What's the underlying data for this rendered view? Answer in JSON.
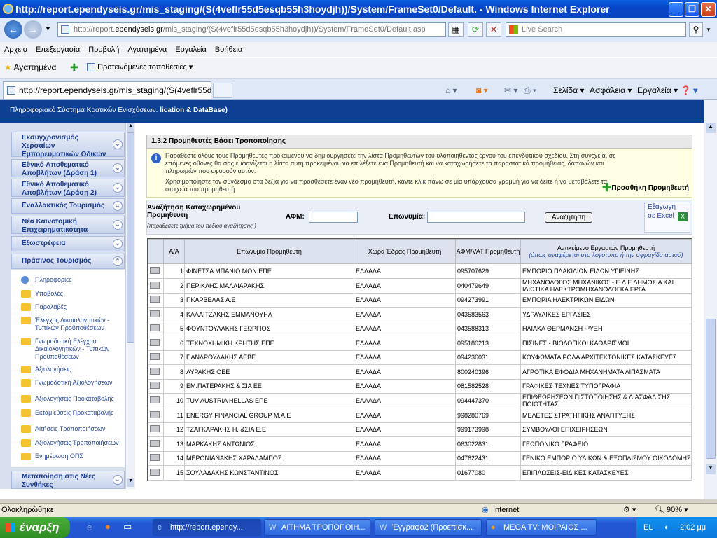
{
  "window": {
    "title": "http://report.ependyseis.gr/mis_staging/(S(4veflr55d5esqb55h3hoydjh))/System/FrameSet0/Default. - Windows Internet Explorer"
  },
  "address": {
    "prefix": "http://report.",
    "domain": "ependyseis.gr",
    "suffix": "/mis_staging/(S(4veflr55d5esqb55h3hoydjh))/System/FrameSet0/Default.asp",
    "search_placeholder": "Live Search"
  },
  "menu": [
    "Αρχείο",
    "Επεξεργασία",
    "Προβολή",
    "Αγαπημένα",
    "Εργαλεία",
    "Βοήθεια"
  ],
  "favbar": {
    "favorites": "Αγαπημένα",
    "suggested": "Προτεινόμενες τοποθεσίες"
  },
  "tab": {
    "title": "http://report.ependyseis.gr/mis_staging/(S(4veflr55d..."
  },
  "commandbar": {
    "page": "Σελίδα",
    "safety": "Ασφάλεια",
    "tools": "Εργαλεία"
  },
  "header": {
    "title": "Πληροφοριακό Σύστημα Κρατικών Ενισχύσεων.",
    "title_suffix": "lication & DataBase)"
  },
  "sidebar": {
    "sections": [
      "Εκσυγχρονισμός Χερσαίων Εμπορευματικών Οδικών Μεταφορών",
      "Εθνικό Αποθεματικό Αποβλήτων (Δράση 1)",
      "Εθνικό Αποθεματικό Αποβλήτων (Δράση 2)",
      "Εναλλακτικός Τουρισμός",
      "Νέα Καινοτομική Επιχειρηματικότητα",
      "Εξωστρέφεια",
      "Πράσινος Τουρισμός"
    ],
    "items": [
      "Πληροφορίες",
      "Υποβολές",
      "Παραλαβές",
      "Έλεγχος Δικαιολογητικών - Τυπικών Προϋποθέσεων",
      "Γνωμοδοτική Ελέγχου Δικαιολογητικών - Τυπικών Προϋποθέσεων",
      "Αξιολογήσεις",
      "Γνωμοδοτική Αξιολογήσεων",
      "Αξιολογήσεις Προκαταβολής",
      "Εκταμιεύσεις Προκαταβολής",
      "Αιτήσεις Τροποποιήσεων",
      "Αξιολογήσεις Τροποποιήσεων",
      "Ενημέρωση ΟΠΣ"
    ],
    "bottom_section": "Μεταποίηση στις Νέες Συνθήκες"
  },
  "main": {
    "section_title": "1.3.2 Προμηθευτές Βάσει Τροποποίησης",
    "info_p1": "Παραθέστε όλους τους Προμηθευτές προκειμένου να δημιουργήσετε την λίστα Προμηθευτών του υλοποιηθέντος έργου του επενδυτικού σχεδίου. Στη συνέχεια, σε επόμενες οθόνες θα σας εμφανίζεται η λίστα αυτή προκειμένου να επιλέξετε ένα Προμηθευτή και να καταχωρήσετε τα παραστατικά προμήθειας, δαπανών και πληρωμών που αφορούν αυτόν.",
    "info_p2": "Χρησιμοποιήστε τον σύνδεσμο στα δεξιά για να προσθέσετε έναν νέο προμηθευτή, κάντε κλικ πάνω σε μία υπάρχουσα γραμμή για να δείτε ή να μεταβάλετε τα στοιχεία του προμηθευτή",
    "add_supplier": "Προσθήκη Προμηθευτή",
    "search": {
      "title": "Αναζήτηση Καταχωρημένου Προμηθευτή",
      "hint": "(παραθέσετε τμήμα του πεδίου αναζήτησης )",
      "afm_label": "ΑΦΜ:",
      "name_label": "Επωνυμία:",
      "button": "Αναζήτηση",
      "export": "Εξαγωγή σε Excel"
    },
    "table": {
      "headers": {
        "aa": "Α/Α",
        "name": "Επωνυμία Προμηθευτή",
        "country": "Χώρα Έδρας Προμηθευτή",
        "afm": "ΑΦΜ/VAT Προμηθευτή",
        "object": "Αντικείμενο Εργασιών Προμηθευτή",
        "object_note": "(όπως αναφέρεται στο λογότυπο ή την σφραγίδα αυτού)"
      },
      "rows": [
        {
          "aa": "1",
          "name": "ΦΙΝΕΤΣΑ ΜΠΑΝΙΟ ΜΟΝ.ΕΠΕ",
          "country": "ΕΛΛΑΔΑ",
          "afm": "095707629",
          "object": "ΕΜΠΟΡΙΟ ΠΛΑΚΙΔΙΩΝ ΕΙΔΩΝ ΥΓΙΕΙΝΗΣ"
        },
        {
          "aa": "2",
          "name": "ΠΕΡΙΚΛΗΣ ΜΑΛΛΙΑΡΑΚΗΣ",
          "country": "ΕΛΛΑΔΑ",
          "afm": "040479649",
          "object": "ΜΗΧΑΝΟΛΟΓΟΣ ΜΗΧΑΝΙΚΟΣ - Ε.Δ.Ε ΔΗΜΟΣΙΑ ΚΑΙ ΙΔΙΩΤΙΚΑ ΗΛΕΚΤΡΟΜΗΧΑΝΟΛΟΓΚΑ ΕΡΓΑ"
        },
        {
          "aa": "3",
          "name": "Γ.ΚΑΡΒΕΛΑΣ Α.Ε",
          "country": "ΕΛΛΑΔΑ",
          "afm": "094273991",
          "object": "ΕΜΠΟΡΙΑ ΗΛΕΚΤΡΙΚΩΝ ΕΙΔΩΝ"
        },
        {
          "aa": "4",
          "name": "ΚΑΛΑΙΤΖΑΚΗΣ ΕΜΜΑΝΟΥΗΛ",
          "country": "ΕΛΛΑΔΑ",
          "afm": "043583563",
          "object": "ΥΔΡΑΥΛΙΚΕΣ ΕΡΓΑΣΙΕΣ"
        },
        {
          "aa": "5",
          "name": "ΦΟΥΝΤΟΥΛΑΚΗΣ ΓΕΩΡΓΙΟΣ",
          "country": "ΕΛΛΑΔΑ",
          "afm": "043588313",
          "object": "ΗΛΙΑΚΑ ΘΕΡΜΑΝΣΗ ΨΥΞΗ"
        },
        {
          "aa": "6",
          "name": "ΤΕΧΝΟΧΗΜΙΚΗ ΚΡΗΤΗΣ ΕΠΕ",
          "country": "ΕΛΛΑΔΑ",
          "afm": "095180213",
          "object": "ΠΙΣΙΝΕΣ - ΒΙΟΛΟΓΙΚΟΙ ΚΑΘΑΡΙΣΜΟΙ"
        },
        {
          "aa": "7",
          "name": "Γ.ΑΝΔΡΟΥΛΑΚΗΣ ΑΕΒΕ",
          "country": "ΕΛΛΑΔΑ",
          "afm": "094236031",
          "object": "ΚΟΥΦΩΜΑΤΑ ΡΟΛΑ ΑΡΧΙΤΕΚΤΟΝΙΚΕΣ ΚΑΤΑΣΚΕΥΕΣ"
        },
        {
          "aa": "8",
          "name": "ΛΥΡΑΚΗΣ ΟΕΕ",
          "country": "ΕΛΛΑΔΑ",
          "afm": "800240396",
          "object": "ΑΓΡΟΤΙΚΑ ΕΦΟΔΙΑ ΜΗΧΑΝΗΜΑΤΑ ΛΙΠΑΣΜΑΤΑ"
        },
        {
          "aa": "9",
          "name": "ΕΜ.ΠΑΤΕΡΑΚΗΣ & ΣΙΑ ΕΕ",
          "country": "ΕΛΛΑΔΑ",
          "afm": "081582528",
          "object": "ΓΡΑΦΙΚΕΣ ΤΕΧΝΕΣ ΤΥΠΟΓΡΑΦΙΑ"
        },
        {
          "aa": "10",
          "name": "TUV AUSTRIA HELLAS ΕΠΕ",
          "country": "ΕΛΛΑΔΑ",
          "afm": "094447370",
          "object": "ΕΠΙΘΕΩΡΗΣΕΩΝ ΠΙΣΤΟΠΟΙΗΣΗΣ & ΔΙΑΣΦΑΛΙΣΗΣ ΠΟΙΟΤΗΤΑΣ"
        },
        {
          "aa": "11",
          "name": "ENERGY FINANCIAL GROUP M.A.E",
          "country": "ΕΛΛΑΔΑ",
          "afm": "998280769",
          "object": "ΜΕΛΕΤΕΣ ΣΤΡΑΤΗΓΙΚΗΣ ΑΝΑΠΤΥΞΗΣ"
        },
        {
          "aa": "12",
          "name": "ΤΖΑΓΚΑΡΑΚΗΣ Η. &ΣΙΑ Ε.Ε",
          "country": "ΕΛΛΑΔΑ",
          "afm": "999173998",
          "object": "ΣΥΜΒΟΥΛΟΙ ΕΠΙΧΕΙΡΗΣΕΩΝ"
        },
        {
          "aa": "13",
          "name": "ΜΑΡΚΑΚΗΣ ΑΝΤΩΝΙΟΣ",
          "country": "ΕΛΛΑΔΑ",
          "afm": "063022831",
          "object": "ΓΕΩΠΟΝΙΚΟ ΓΡΑΦΕΙΟ"
        },
        {
          "aa": "14",
          "name": "ΜΕΡΟΝΙΑΝΑΚΗΣ ΧΑΡΑΛΑΜΠΟΣ",
          "country": "ΕΛΛΑΔΑ",
          "afm": "047622431",
          "object": "ΓΕΝΙΚΟ ΕΜΠΟΡΙΟ ΥΛΙΚΩΝ & ΕΞΟΠΛΙΣΜΟΥ ΟΙΚΟΔΟΜΗΣ"
        },
        {
          "aa": "15",
          "name": "ΣΟΥΛΑΔΑΚΗΣ ΚΩΝΣΤΑΝΤΙΝΟΣ",
          "country": "ΕΛΛΑΔΑ",
          "afm": "01677080",
          "object": "ΕΠΙΠΛΩΣΕΙΣ-ΕΙΔΙΚΕΣ ΚΑΤΑΣΚΕΥΕΣ"
        }
      ]
    }
  },
  "status": {
    "text": "Ολοκληρώθηκε",
    "zone": "Internet",
    "zoom": "90%"
  },
  "taskbar": {
    "start": "έναρξη",
    "buttons": [
      "http://report.ependy...",
      "ΑΙΤΗΜΑ ΤΡΟΠΟΠΟΙΗ...",
      "Έγγραφο2 (Προεπισκ...",
      "MEGA TV: ΜΟΙΡΑΙΟΣ ..."
    ],
    "lang": "EL",
    "time": "2:02 μμ"
  }
}
